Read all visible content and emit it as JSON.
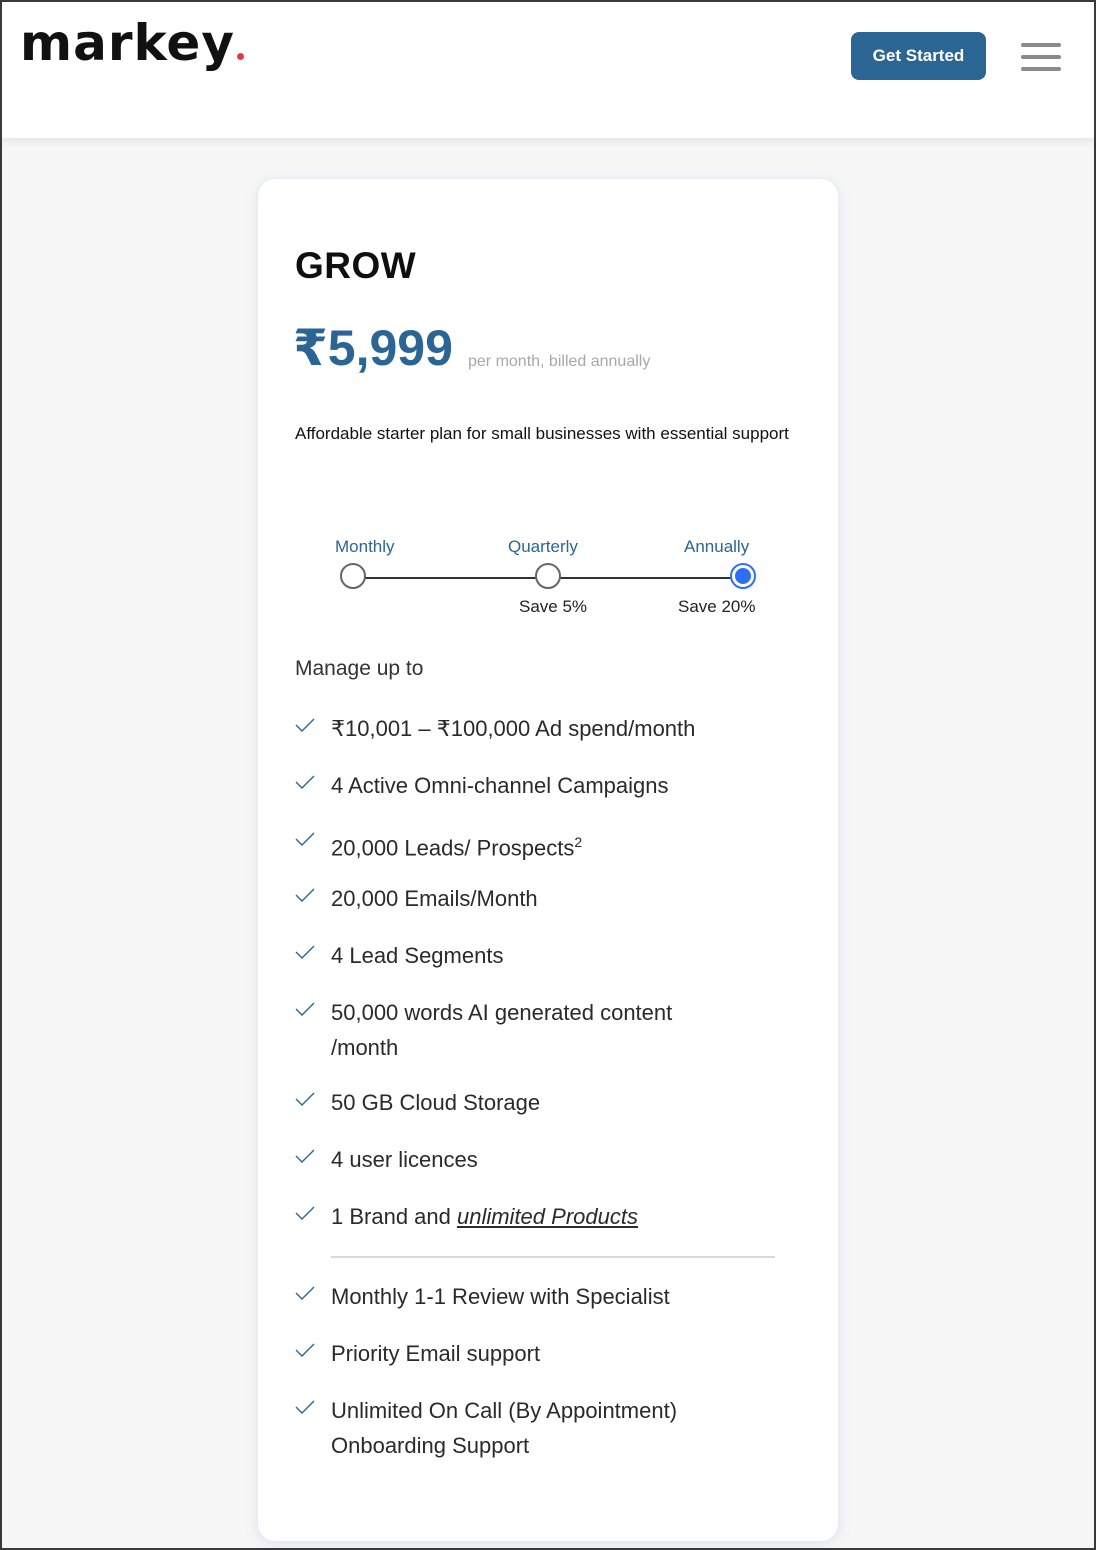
{
  "header": {
    "logo_text": "markey",
    "logo_dot_color": "#e23b3b",
    "cta_label": "Get Started",
    "cta_color": "#2b6594",
    "menu_icon": "hamburger-menu-icon"
  },
  "plan": {
    "title": "GROW",
    "price": "₹5,999",
    "price_note": "per month, billed annually",
    "description": "Affordable starter plan for small businesses with essential support",
    "accent_color": "#2b6594"
  },
  "billing": {
    "options": [
      {
        "label": "Monthly",
        "save": "",
        "selected": false
      },
      {
        "label": "Quarterly",
        "save": "Save 5%",
        "selected": false
      },
      {
        "label": "Annually",
        "save": "Save 20%",
        "selected": true
      }
    ],
    "selected_color": "#2f6ef2"
  },
  "features": {
    "heading": "Manage up to",
    "check_icon": "checkmark-icon",
    "items": [
      {
        "text": "₹10,001 – ₹100,000 Ad spend/month"
      },
      {
        "text": "4 Active Omni-channel Campaigns"
      },
      {
        "text": "20,000 Leads/ Prospects",
        "sup": "2"
      },
      {
        "text": "20,000 Emails/Month"
      },
      {
        "text": "4 Lead Segments"
      },
      {
        "text": "50,000 words AI generated content /month"
      },
      {
        "text": "50 GB Cloud Storage"
      },
      {
        "text": "4 user licences"
      },
      {
        "text": "1 Brand and ",
        "link": "unlimited Products"
      }
    ],
    "support_items": [
      {
        "text": "Monthly 1-1 Review with Specialist"
      },
      {
        "text": "Priority Email support"
      },
      {
        "text": "Unlimited On Call (By Appointment) Onboarding Support"
      }
    ]
  }
}
